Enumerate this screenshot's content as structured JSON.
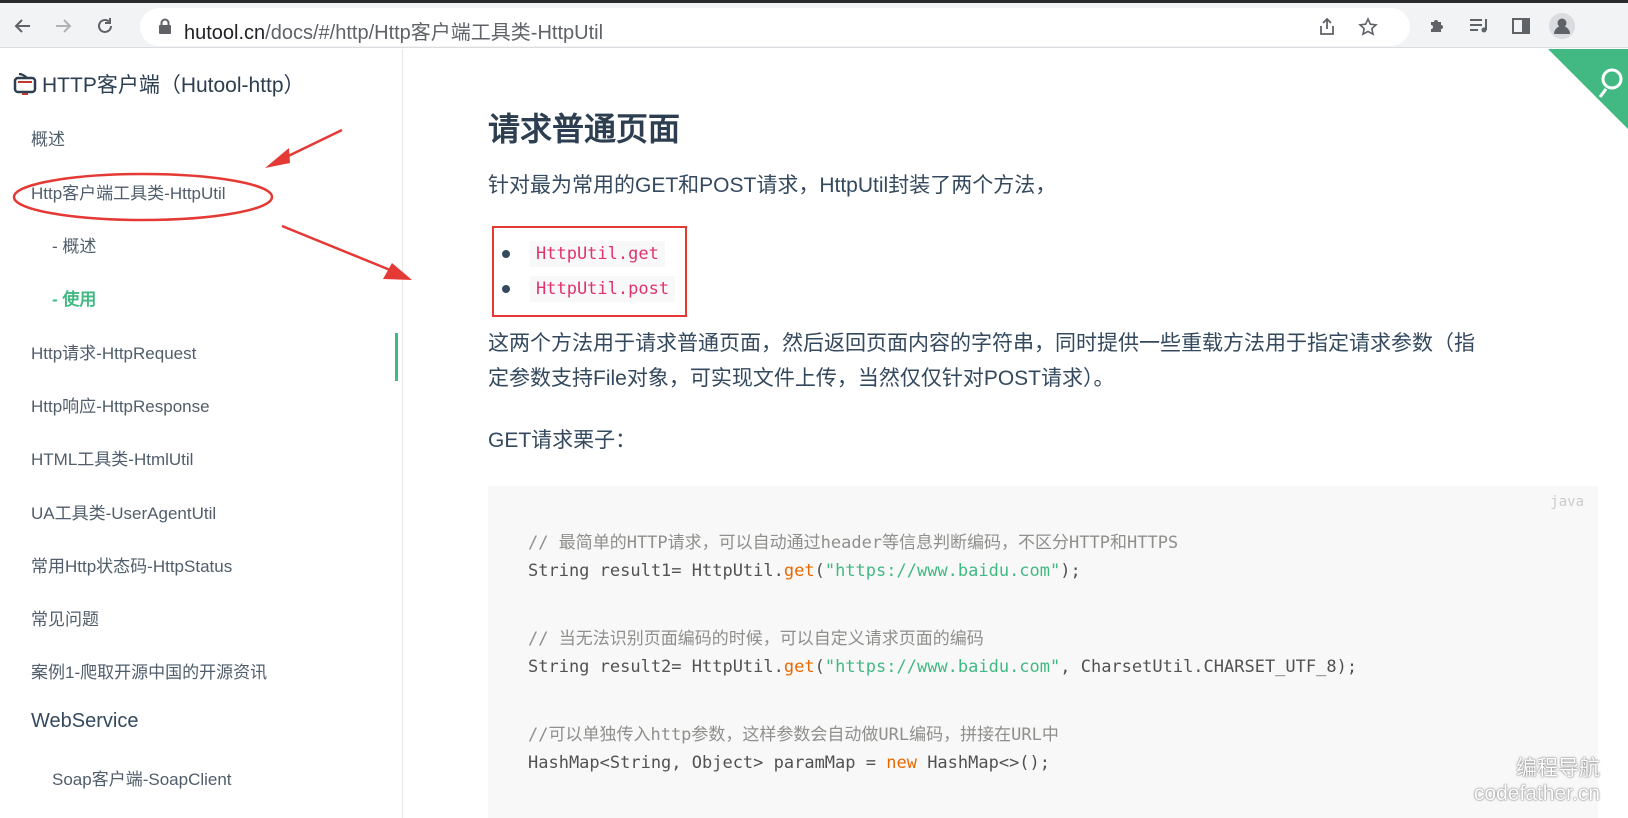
{
  "browser": {
    "url_host": "hutool.cn",
    "url_path": "/docs/#/http/Http客户端工具类-HttpUtil"
  },
  "sidebar": {
    "title": "HTTP客户端（Hutool-http）",
    "items": [
      {
        "label": "概述"
      },
      {
        "label": "Http客户端工具类-HttpUtil"
      },
      {
        "label": "- 概述"
      },
      {
        "label": "- 使用"
      },
      {
        "label": "Http请求-HttpRequest"
      },
      {
        "label": "Http响应-HttpResponse"
      },
      {
        "label": "HTML工具类-HtmlUtil"
      },
      {
        "label": "UA工具类-UserAgentUtil"
      },
      {
        "label": "常用Http状态码-HttpStatus"
      },
      {
        "label": "常见问题"
      },
      {
        "label": "案例1-爬取开源中国的开源资讯"
      },
      {
        "label": "WebService"
      },
      {
        "label": "Soap客户端-SoapClient"
      }
    ]
  },
  "content": {
    "heading": "请求普通页面",
    "intro": "针对最为常用的GET和POST请求，HttpUtil封装了两个方法，",
    "methods": [
      "HttpUtil.get",
      "HttpUtil.post"
    ],
    "desc_line1": "这两个方法用于请求普通页面，然后返回页面内容的字符串，同时提供一些重载方法用于指定请求参数（指",
    "desc_line2": "定参数支持File对象，可实现文件上传，当然仅仅针对POST请求）。",
    "example_label": "GET请求栗子：",
    "code_lang": "java",
    "code": {
      "c1": "// 最简单的HTTP请求，可以自动通过header等信息判断编码，不区分HTTP和HTTPS",
      "l1a": "String result1= HttpUtil.",
      "l1b": "get",
      "l1c": "(",
      "l1d": "\"https://www.baidu.com\"",
      "l1e": ");",
      "c2": "// 当无法识别页面编码的时候，可以自定义请求页面的编码",
      "l2a": "String result2= HttpUtil.",
      "l2b": "get",
      "l2c": "(",
      "l2d": "\"https://www.baidu.com\"",
      "l2e": ", CharsetUtil.CHARSET_UTF_8);",
      "c3": "//可以单独传入http参数，这样参数会自动做URL编码，拼接在URL中",
      "l3a": "HashMap<String, Object> paramMap = ",
      "l3b": "new",
      "l3c": " HashMap<>();"
    }
  },
  "watermark": {
    "line1": "编程导航",
    "line2": "codefather.cn"
  },
  "colors": {
    "accent": "#42b983",
    "annotation_red": "#e53935",
    "inline_code": "#e0336e"
  }
}
